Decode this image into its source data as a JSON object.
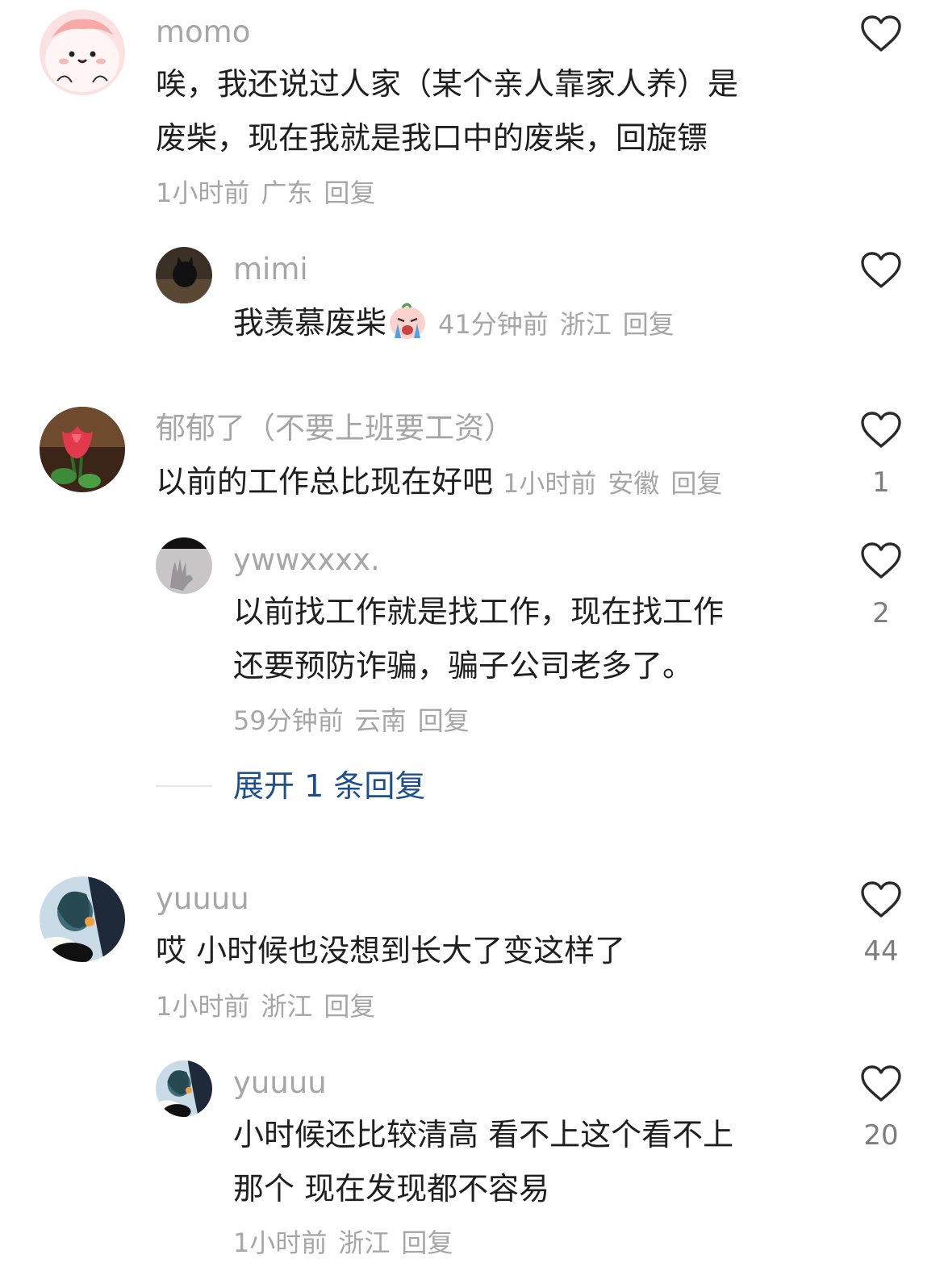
{
  "comments": [
    {
      "username": "momo",
      "text_lines": [
        "唉，我还说过人家（某个亲人靠家人养）是",
        "废柴，现在我就是我口中的废柴，回旋镖"
      ],
      "time": "1小时前",
      "location": "广东",
      "reply_label": "回复",
      "likes": "",
      "avatar_icon": "cartoon-pink-avatar",
      "replies": [
        {
          "username": "mimi",
          "text": "我羡慕废柴",
          "emoji_icon": "crying-emoji",
          "time": "41分钟前",
          "location": "浙江",
          "reply_label": "回复",
          "likes": "",
          "avatar_icon": "black-cat-avatar"
        }
      ]
    },
    {
      "username": "郁郁了（不要上班要工资）",
      "text": "以前的工作总比现在好吧",
      "time": "1小时前",
      "location": "安徽",
      "reply_label": "回复",
      "likes": "1",
      "avatar_icon": "tulip-avatar",
      "replies": [
        {
          "username": "ywwxxxx.",
          "text_lines": [
            "以前找工作就是找工作，现在找工作",
            "还要预防诈骗，骗子公司老多了。"
          ],
          "time": "59分钟前",
          "location": "云南",
          "reply_label": "回复",
          "likes": "2",
          "avatar_icon": "hand-shadow-avatar"
        }
      ],
      "expand_label": "展开 1 条回复"
    },
    {
      "username": "yuuuu",
      "text": "哎 小时候也没想到长大了变这样了",
      "time": "1小时前",
      "location": "浙江",
      "reply_label": "回复",
      "likes": "44",
      "avatar_icon": "anime-girl-avatar",
      "replies": [
        {
          "username": "yuuuu",
          "text_lines": [
            "小时候还比较清高 看不上这个看不上",
            "那个 现在发现都不容易"
          ],
          "time": "1小时前",
          "location": "浙江",
          "reply_label": "回复",
          "likes": "20",
          "avatar_icon": "anime-girl-avatar"
        }
      ]
    }
  ],
  "colors": {
    "text": "#1f1f1f",
    "meta": "#a6a6a6",
    "link": "#1d4f8c",
    "heart": "#2a2a2a"
  }
}
